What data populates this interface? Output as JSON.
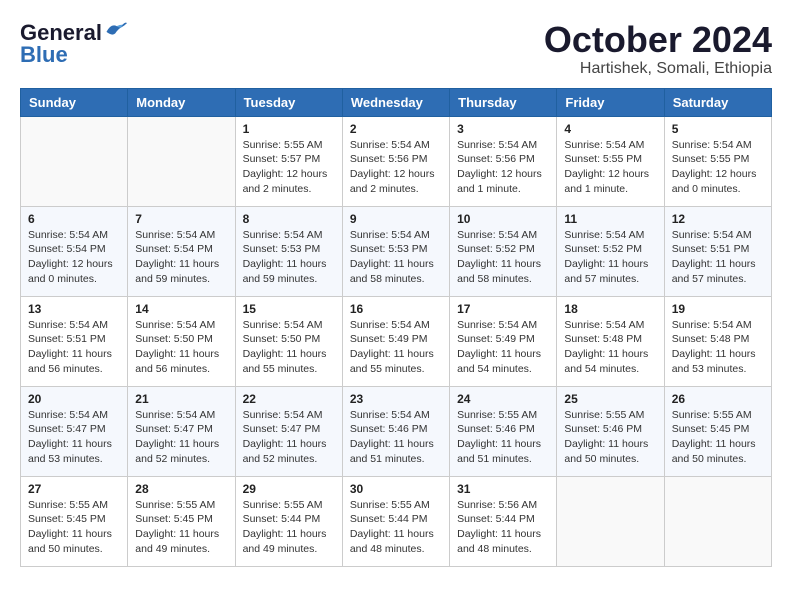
{
  "header": {
    "logo_general": "General",
    "logo_blue": "Blue",
    "month_title": "October 2024",
    "location": "Hartishek, Somali, Ethiopia"
  },
  "weekdays": [
    "Sunday",
    "Monday",
    "Tuesday",
    "Wednesday",
    "Thursday",
    "Friday",
    "Saturday"
  ],
  "weeks": [
    [
      {
        "day": "",
        "info": ""
      },
      {
        "day": "",
        "info": ""
      },
      {
        "day": "1",
        "info": "Sunrise: 5:55 AM\nSunset: 5:57 PM\nDaylight: 12 hours\nand 2 minutes."
      },
      {
        "day": "2",
        "info": "Sunrise: 5:54 AM\nSunset: 5:56 PM\nDaylight: 12 hours\nand 2 minutes."
      },
      {
        "day": "3",
        "info": "Sunrise: 5:54 AM\nSunset: 5:56 PM\nDaylight: 12 hours\nand 1 minute."
      },
      {
        "day": "4",
        "info": "Sunrise: 5:54 AM\nSunset: 5:55 PM\nDaylight: 12 hours\nand 1 minute."
      },
      {
        "day": "5",
        "info": "Sunrise: 5:54 AM\nSunset: 5:55 PM\nDaylight: 12 hours\nand 0 minutes."
      }
    ],
    [
      {
        "day": "6",
        "info": "Sunrise: 5:54 AM\nSunset: 5:54 PM\nDaylight: 12 hours\nand 0 minutes."
      },
      {
        "day": "7",
        "info": "Sunrise: 5:54 AM\nSunset: 5:54 PM\nDaylight: 11 hours\nand 59 minutes."
      },
      {
        "day": "8",
        "info": "Sunrise: 5:54 AM\nSunset: 5:53 PM\nDaylight: 11 hours\nand 59 minutes."
      },
      {
        "day": "9",
        "info": "Sunrise: 5:54 AM\nSunset: 5:53 PM\nDaylight: 11 hours\nand 58 minutes."
      },
      {
        "day": "10",
        "info": "Sunrise: 5:54 AM\nSunset: 5:52 PM\nDaylight: 11 hours\nand 58 minutes."
      },
      {
        "day": "11",
        "info": "Sunrise: 5:54 AM\nSunset: 5:52 PM\nDaylight: 11 hours\nand 57 minutes."
      },
      {
        "day": "12",
        "info": "Sunrise: 5:54 AM\nSunset: 5:51 PM\nDaylight: 11 hours\nand 57 minutes."
      }
    ],
    [
      {
        "day": "13",
        "info": "Sunrise: 5:54 AM\nSunset: 5:51 PM\nDaylight: 11 hours\nand 56 minutes."
      },
      {
        "day": "14",
        "info": "Sunrise: 5:54 AM\nSunset: 5:50 PM\nDaylight: 11 hours\nand 56 minutes."
      },
      {
        "day": "15",
        "info": "Sunrise: 5:54 AM\nSunset: 5:50 PM\nDaylight: 11 hours\nand 55 minutes."
      },
      {
        "day": "16",
        "info": "Sunrise: 5:54 AM\nSunset: 5:49 PM\nDaylight: 11 hours\nand 55 minutes."
      },
      {
        "day": "17",
        "info": "Sunrise: 5:54 AM\nSunset: 5:49 PM\nDaylight: 11 hours\nand 54 minutes."
      },
      {
        "day": "18",
        "info": "Sunrise: 5:54 AM\nSunset: 5:48 PM\nDaylight: 11 hours\nand 54 minutes."
      },
      {
        "day": "19",
        "info": "Sunrise: 5:54 AM\nSunset: 5:48 PM\nDaylight: 11 hours\nand 53 minutes."
      }
    ],
    [
      {
        "day": "20",
        "info": "Sunrise: 5:54 AM\nSunset: 5:47 PM\nDaylight: 11 hours\nand 53 minutes."
      },
      {
        "day": "21",
        "info": "Sunrise: 5:54 AM\nSunset: 5:47 PM\nDaylight: 11 hours\nand 52 minutes."
      },
      {
        "day": "22",
        "info": "Sunrise: 5:54 AM\nSunset: 5:47 PM\nDaylight: 11 hours\nand 52 minutes."
      },
      {
        "day": "23",
        "info": "Sunrise: 5:54 AM\nSunset: 5:46 PM\nDaylight: 11 hours\nand 51 minutes."
      },
      {
        "day": "24",
        "info": "Sunrise: 5:55 AM\nSunset: 5:46 PM\nDaylight: 11 hours\nand 51 minutes."
      },
      {
        "day": "25",
        "info": "Sunrise: 5:55 AM\nSunset: 5:46 PM\nDaylight: 11 hours\nand 50 minutes."
      },
      {
        "day": "26",
        "info": "Sunrise: 5:55 AM\nSunset: 5:45 PM\nDaylight: 11 hours\nand 50 minutes."
      }
    ],
    [
      {
        "day": "27",
        "info": "Sunrise: 5:55 AM\nSunset: 5:45 PM\nDaylight: 11 hours\nand 50 minutes."
      },
      {
        "day": "28",
        "info": "Sunrise: 5:55 AM\nSunset: 5:45 PM\nDaylight: 11 hours\nand 49 minutes."
      },
      {
        "day": "29",
        "info": "Sunrise: 5:55 AM\nSunset: 5:44 PM\nDaylight: 11 hours\nand 49 minutes."
      },
      {
        "day": "30",
        "info": "Sunrise: 5:55 AM\nSunset: 5:44 PM\nDaylight: 11 hours\nand 48 minutes."
      },
      {
        "day": "31",
        "info": "Sunrise: 5:56 AM\nSunset: 5:44 PM\nDaylight: 11 hours\nand 48 minutes."
      },
      {
        "day": "",
        "info": ""
      },
      {
        "day": "",
        "info": ""
      }
    ]
  ]
}
